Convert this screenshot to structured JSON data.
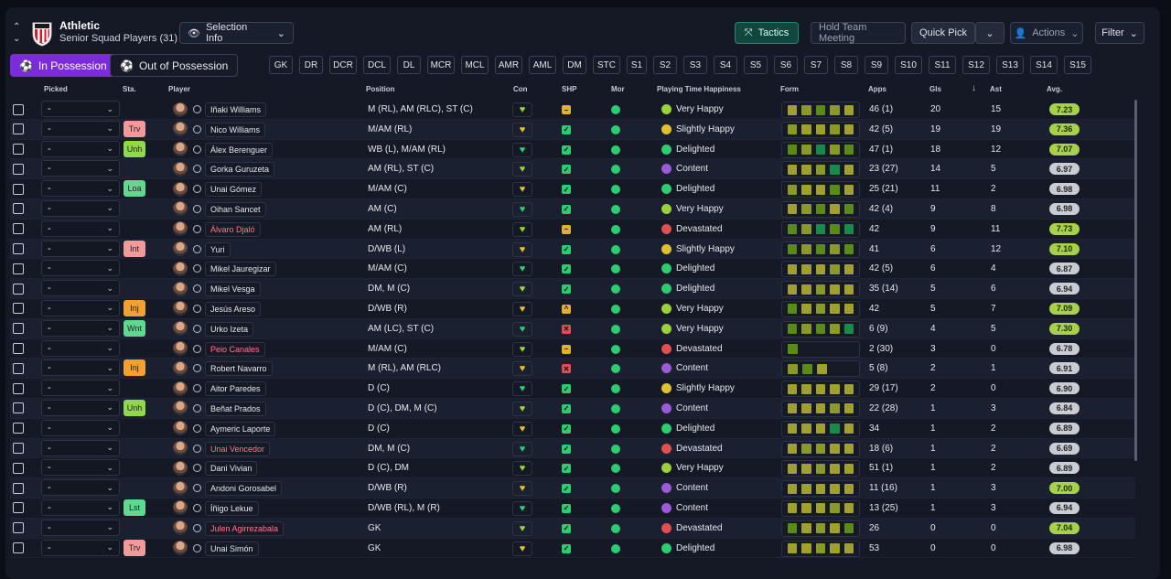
{
  "header": {
    "team_name": "Athletic",
    "squad_view": "Senior Squad Players (31)",
    "selection_info": "Selection Info",
    "tactics": "Tactics",
    "hold_meeting": "Hold Team Meeting",
    "quick_pick": "Quick Pick",
    "actions": "Actions",
    "filter": "Filter"
  },
  "possession": {
    "in": "In Possession",
    "out": "Out of Possession"
  },
  "positions": [
    "GK",
    "DR",
    "DCR",
    "DCL",
    "DL",
    "MCR",
    "MCL",
    "AMR",
    "AML",
    "DM",
    "STC",
    "S1",
    "S2",
    "S3",
    "S4",
    "S5",
    "S6",
    "S7",
    "S8",
    "S9",
    "S10",
    "S11",
    "S12",
    "S13",
    "S14",
    "S15"
  ],
  "columns": {
    "picked": "Picked",
    "sta": "Sta.",
    "player": "Player",
    "position": "Position",
    "con": "Con",
    "shp": "SHP",
    "mor": "Mor",
    "pth": "Playing Time Happiness",
    "form": "Form",
    "apps": "Apps",
    "gls": "Gls",
    "ast": "Ast",
    "avg": "Avg."
  },
  "picked_default": "-",
  "colors": {
    "accent": "#7b2bd9",
    "teal": "#1f8c72",
    "green": "#2ecc71",
    "avg_high": "#a7d14a",
    "avg_low": "#c9ccd3"
  },
  "players": [
    {
      "name": "Iñaki Williams",
      "sta": "",
      "position": "M (RL), AM (RLC), ST (C)",
      "shp": "yellow",
      "happiness": "Very Happy",
      "face": "#9bd13a",
      "form": [
        "#a0a030",
        "#8a9a2a",
        "#5a8a1a",
        "#8a9a2a",
        "#a0a030"
      ],
      "apps": "46 (1)",
      "gls": "20",
      "ast": "15",
      "avg": "7.23",
      "red": false
    },
    {
      "name": "Nico Williams",
      "sta": "Trv",
      "position": "M/AM (RL)",
      "shp": "green",
      "happiness": "Slightly Happy",
      "face": "#e0c030",
      "form": [
        "#8a9a2a",
        "#a0a030",
        "#a0a030",
        "#8a9a2a",
        "#a0a030"
      ],
      "apps": "42 (5)",
      "gls": "19",
      "ast": "19",
      "avg": "7.36",
      "red": false
    },
    {
      "name": "Álex Berenguer",
      "sta": "Unh",
      "position": "WB (L), M/AM (RL)",
      "shp": "green",
      "happiness": "Delighted",
      "face": "#2ecc71",
      "form": [
        "#5a8a1a",
        "#8a9a2a",
        "#1a8a4a",
        "#8a9a2a",
        "#5a8a1a"
      ],
      "apps": "47 (1)",
      "gls": "18",
      "ast": "12",
      "avg": "7.07",
      "red": false
    },
    {
      "name": "Gorka Guruzeta",
      "sta": "",
      "position": "AM (RL), ST (C)",
      "shp": "green",
      "happiness": "Content",
      "face": "#9a5ad9",
      "form": [
        "#a0a030",
        "#a0a030",
        "#8a9a2a",
        "#1a8a4a",
        "#a0a030"
      ],
      "apps": "23 (27)",
      "gls": "14",
      "ast": "5",
      "avg": "6.97",
      "red": false
    },
    {
      "name": "Unai Gómez",
      "sta": "Loa",
      "position": "M/AM (C)",
      "shp": "green",
      "happiness": "Delighted",
      "face": "#2ecc71",
      "form": [
        "#8a9a2a",
        "#a0a030",
        "#a0a030",
        "#5a8a1a",
        "#a0a030"
      ],
      "apps": "25 (21)",
      "gls": "11",
      "ast": "2",
      "avg": "6.98",
      "red": false
    },
    {
      "name": "Oihan Sancet",
      "sta": "",
      "position": "AM (C)",
      "shp": "green",
      "happiness": "Very Happy",
      "face": "#9bd13a",
      "form": [
        "#a0a030",
        "#8a9a2a",
        "#5a8a1a",
        "#a0a030",
        "#5a8a1a"
      ],
      "apps": "42 (4)",
      "gls": "9",
      "ast": "8",
      "avg": "6.98",
      "red": false
    },
    {
      "name": "Álvaro Djaló",
      "sta": "",
      "position": "AM (RL)",
      "shp": "yellow",
      "happiness": "Devastated",
      "face": "#e05050",
      "form": [
        "#5a8a1a",
        "#8a9a2a",
        "#1a8a4a",
        "#5a8a1a",
        "#1a8a4a"
      ],
      "apps": "42",
      "gls": "9",
      "ast": "11",
      "avg": "7.73",
      "red": true
    },
    {
      "name": "Yuri",
      "sta": "Int",
      "position": "D/WB (L)",
      "shp": "green",
      "happiness": "Slightly Happy",
      "face": "#e0c030",
      "form": [
        "#5a8a1a",
        "#8a9a2a",
        "#5a8a1a",
        "#8a9a2a",
        "#5a8a1a"
      ],
      "apps": "41",
      "gls": "6",
      "ast": "12",
      "avg": "7.10",
      "red": false
    },
    {
      "name": "Mikel Jauregizar",
      "sta": "",
      "position": "M/AM (C)",
      "shp": "green",
      "happiness": "Delighted",
      "face": "#2ecc71",
      "form": [
        "#a0a030",
        "#a0a030",
        "#a0a030",
        "#8a9a2a",
        "#a0a030"
      ],
      "apps": "42 (5)",
      "gls": "6",
      "ast": "4",
      "avg": "6.87",
      "red": false
    },
    {
      "name": "Mikel Vesga",
      "sta": "",
      "position": "DM, M (C)",
      "shp": "green",
      "happiness": "Delighted",
      "face": "#2ecc71",
      "form": [
        "#a0a030",
        "#a0a030",
        "#8a9a2a",
        "#a0a030",
        "#a0a030"
      ],
      "apps": "35 (14)",
      "gls": "5",
      "ast": "6",
      "avg": "6.94",
      "red": false
    },
    {
      "name": "Jesús Areso",
      "sta": "Inj",
      "position": "D/WB (R)",
      "shp": "up",
      "happiness": "Very Happy",
      "face": "#9bd13a",
      "form": [
        "#5a8a1a",
        "#a0a030",
        "#8a9a2a",
        "#a0a030",
        "#a0a030"
      ],
      "apps": "42",
      "gls": "5",
      "ast": "7",
      "avg": "7.09",
      "red": false
    },
    {
      "name": "Urko Izeta",
      "sta": "Wnt",
      "position": "AM (LC), ST (C)",
      "shp": "red",
      "happiness": "Very Happy",
      "face": "#9bd13a",
      "form": [
        "#5a8a1a",
        "#8a9a2a",
        "#5a8a1a",
        "#8a9a2a",
        "#1a8a4a"
      ],
      "apps": "6 (9)",
      "gls": "4",
      "ast": "5",
      "avg": "7.30",
      "red": false
    },
    {
      "name": "Peio Canales",
      "sta": "",
      "position": "M/AM (C)",
      "shp": "yellow",
      "happiness": "Devastated",
      "face": "#e05050",
      "form": [
        "#5a8a1a"
      ],
      "apps": "2 (30)",
      "gls": "3",
      "ast": "0",
      "avg": "6.78",
      "red": true
    },
    {
      "name": "Robert Navarro",
      "sta": "Inj",
      "position": "M (RL), AM (RLC)",
      "shp": "red",
      "happiness": "Content",
      "face": "#9a5ad9",
      "form": [
        "#8a9a2a",
        "#5a8a1a",
        "#a0a030"
      ],
      "apps": "5 (8)",
      "gls": "2",
      "ast": "1",
      "avg": "6.91",
      "red": false
    },
    {
      "name": "Aitor Paredes",
      "sta": "",
      "position": "D (C)",
      "shp": "green",
      "happiness": "Slightly Happy",
      "face": "#e0c030",
      "form": [
        "#a0a030",
        "#a0a030",
        "#a0a030",
        "#a0a030",
        "#a0a030"
      ],
      "apps": "29 (17)",
      "gls": "2",
      "ast": "0",
      "avg": "6.90",
      "red": false
    },
    {
      "name": "Beñat Prados",
      "sta": "Unh",
      "position": "D (C), DM, M (C)",
      "shp": "green",
      "happiness": "Content",
      "face": "#9a5ad9",
      "form": [
        "#a0a030",
        "#a0a030",
        "#a0a030",
        "#8a9a2a",
        "#a0a030"
      ],
      "apps": "22 (28)",
      "gls": "1",
      "ast": "3",
      "avg": "6.84",
      "red": false
    },
    {
      "name": "Aymeric Laporte",
      "sta": "",
      "position": "D (C)",
      "shp": "green",
      "happiness": "Delighted",
      "face": "#2ecc71",
      "form": [
        "#a0a030",
        "#a0a030",
        "#a0a030",
        "#1a8a4a",
        "#a0a030"
      ],
      "apps": "34",
      "gls": "1",
      "ast": "2",
      "avg": "6.89",
      "red": false
    },
    {
      "name": "Unai Vencedor",
      "sta": "",
      "position": "DM, M (C)",
      "shp": "green",
      "happiness": "Devastated",
      "face": "#e05050",
      "form": [
        "#a0a030",
        "#8a9a2a",
        "#8a9a2a",
        "#a0a030",
        "#a0a030"
      ],
      "apps": "18 (6)",
      "gls": "1",
      "ast": "2",
      "avg": "6.69",
      "red": true
    },
    {
      "name": "Dani Vivian",
      "sta": "",
      "position": "D (C), DM",
      "shp": "green",
      "happiness": "Very Happy",
      "face": "#9bd13a",
      "form": [
        "#a0a030",
        "#a0a030",
        "#8a9a2a",
        "#a0a030",
        "#a0a030"
      ],
      "apps": "51 (1)",
      "gls": "1",
      "ast": "2",
      "avg": "6.89",
      "red": false
    },
    {
      "name": "Andoni Gorosabel",
      "sta": "",
      "position": "D/WB (R)",
      "shp": "green",
      "happiness": "Content",
      "face": "#9a5ad9",
      "form": [
        "#a0a030",
        "#a0a030",
        "#a0a030",
        "#a0a030",
        "#a0a030"
      ],
      "apps": "11 (16)",
      "gls": "1",
      "ast": "3",
      "avg": "7.00",
      "red": false
    },
    {
      "name": "Íñigo Lekue",
      "sta": "Lst",
      "position": "D/WB (RL), M (R)",
      "shp": "green",
      "happiness": "Content",
      "face": "#9a5ad9",
      "form": [
        "#a0a030",
        "#a0a030",
        "#a0a030",
        "#8a9a2a",
        "#a0a030"
      ],
      "apps": "13 (25)",
      "gls": "1",
      "ast": "3",
      "avg": "6.94",
      "red": false
    },
    {
      "name": "Julen Agirrezabala",
      "sta": "",
      "position": "GK",
      "shp": "green",
      "happiness": "Devastated",
      "face": "#e05050",
      "form": [
        "#5a8a1a",
        "#a0a030",
        "#8a9a2a",
        "#a0a030",
        "#5a8a1a"
      ],
      "apps": "26",
      "gls": "0",
      "ast": "0",
      "avg": "7.04",
      "red": true
    },
    {
      "name": "Unai Simón",
      "sta": "Trv",
      "position": "GK",
      "shp": "green",
      "happiness": "Delighted",
      "face": "#2ecc71",
      "form": [
        "#a0a030",
        "#a0a030",
        "#8a9a2a",
        "#a0a030",
        "#a0a030"
      ],
      "apps": "53",
      "gls": "0",
      "ast": "0",
      "avg": "6.98",
      "red": false
    }
  ]
}
